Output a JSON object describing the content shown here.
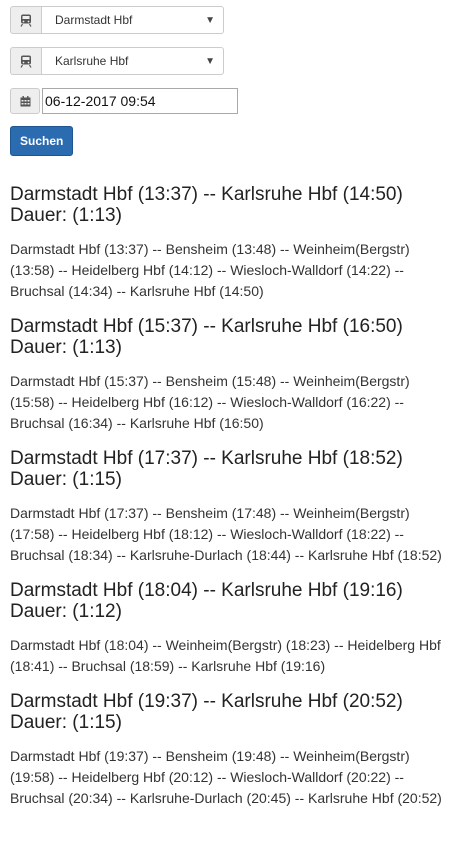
{
  "form": {
    "from_station": "Darmstadt Hbf",
    "to_station": "Karlsruhe Hbf",
    "datetime": "06-12-2017 09:54",
    "search_label": "Suchen"
  },
  "icons": {
    "station": "train-icon",
    "dropdown": "caret-down-icon",
    "date": "calendar-icon"
  },
  "colors": {
    "primary_button": "#2b6bb0"
  },
  "results": [
    {
      "summary": "Darmstadt Hbf (13:37) -- Karlsruhe Hbf (14:50)",
      "duration": "Dauer: (1:13)",
      "stops": "Darmstadt Hbf (13:37) -- Bensheim (13:48) -- Weinheim(Bergstr) (13:58) -- Heidelberg Hbf (14:12) -- Wiesloch-Walldorf (14:22) -- Bruchsal (14:34) -- Karlsruhe Hbf (14:50)"
    },
    {
      "summary": "Darmstadt Hbf (15:37) -- Karlsruhe Hbf (16:50)",
      "duration": "Dauer: (1:13)",
      "stops": "Darmstadt Hbf (15:37) -- Bensheim (15:48) -- Weinheim(Bergstr) (15:58) -- Heidelberg Hbf (16:12) -- Wiesloch-Walldorf (16:22) -- Bruchsal (16:34) -- Karlsruhe Hbf (16:50)"
    },
    {
      "summary": "Darmstadt Hbf (17:37) -- Karlsruhe Hbf (18:52)",
      "duration": "Dauer: (1:15)",
      "stops": "Darmstadt Hbf (17:37) -- Bensheim (17:48) -- Weinheim(Bergstr) (17:58) -- Heidelberg Hbf (18:12) -- Wiesloch-Walldorf (18:22) -- Bruchsal (18:34) -- Karlsruhe-Durlach (18:44) -- Karlsruhe Hbf (18:52)"
    },
    {
      "summary": "Darmstadt Hbf (18:04) -- Karlsruhe Hbf (19:16)",
      "duration": "Dauer: (1:12)",
      "stops": "Darmstadt Hbf (18:04) -- Weinheim(Bergstr) (18:23) -- Heidelberg Hbf (18:41) -- Bruchsal (18:59) -- Karlsruhe Hbf (19:16)"
    },
    {
      "summary": "Darmstadt Hbf (19:37) -- Karlsruhe Hbf (20:52)",
      "duration": "Dauer: (1:15)",
      "stops": "Darmstadt Hbf (19:37) -- Bensheim (19:48) -- Weinheim(Bergstr) (19:58) -- Heidelberg Hbf (20:12) -- Wiesloch-Walldorf (20:22) -- Bruchsal (20:34) -- Karlsruhe-Durlach (20:45) -- Karlsruhe Hbf (20:52)"
    }
  ]
}
